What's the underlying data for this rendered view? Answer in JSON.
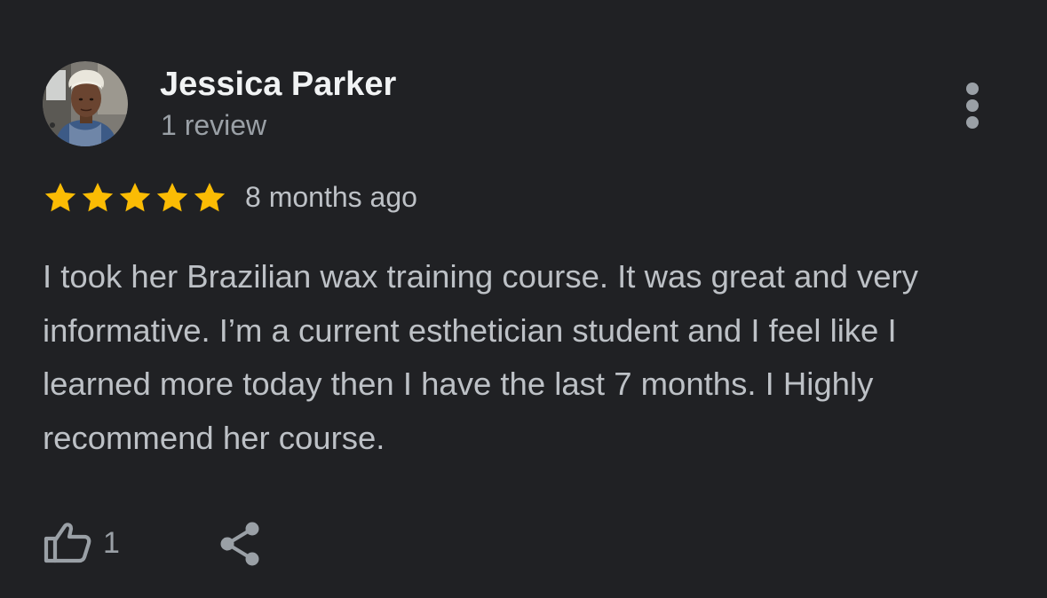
{
  "review": {
    "author_name": "Jessica Parker",
    "author_meta": "1 review",
    "rating": 5,
    "rating_max": 5,
    "time_ago": "8 months ago",
    "text": "I took her Brazilian wax training course. It was great and very informative. I’m a current esthetician student and I feel like I learned more today then I have the last 7 months. I Highly recommend her course.",
    "like_count": "1"
  },
  "icons": {
    "more": "more-vert-icon",
    "like": "thumbs-up-icon",
    "share": "share-icon",
    "star": "star-icon"
  },
  "colors": {
    "background": "#202124",
    "star": "#fbbc04",
    "name": "#f1f3f4",
    "secondary": "#9aa0a6",
    "body_text": "#bdc1c6"
  }
}
